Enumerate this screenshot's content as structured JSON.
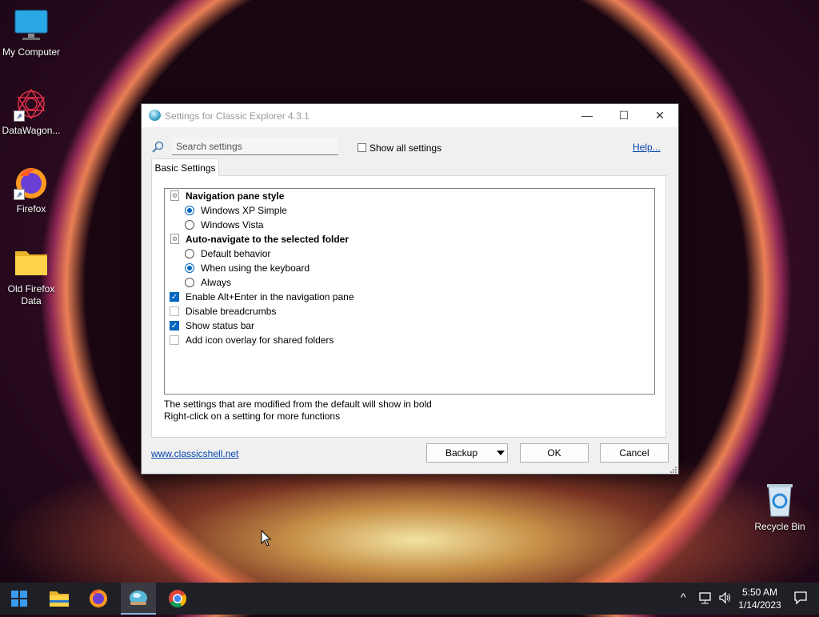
{
  "desktop": {
    "icons": [
      {
        "label": "My Computer",
        "icon": "monitor-icon"
      },
      {
        "label": "DataWagon...",
        "icon": "datawagon-icon"
      },
      {
        "label": "Firefox",
        "icon": "firefox-icon"
      },
      {
        "label": "Old Firefox Data",
        "icon": "folder-icon"
      },
      {
        "label": "Recycle Bin",
        "icon": "recycle-bin-icon"
      }
    ],
    "shortcut_glyph": "↗"
  },
  "window": {
    "title": "Settings for Classic Explorer 4.3.1",
    "controls": {
      "minimize": "—",
      "maximize": "☐",
      "close": "✕"
    },
    "search": {
      "placeholder": "Search settings",
      "value": ""
    },
    "show_all_settings": {
      "label": "Show all settings",
      "checked": false
    },
    "help_link": "Help...",
    "tab": "Basic Settings",
    "settings": [
      {
        "type": "group",
        "label": "Navigation pane style"
      },
      {
        "type": "radio",
        "label": "Windows XP Simple",
        "checked": true
      },
      {
        "type": "radio",
        "label": "Windows Vista",
        "checked": false
      },
      {
        "type": "group",
        "label": "Auto-navigate to the selected folder"
      },
      {
        "type": "radio",
        "label": "Default behavior",
        "checked": false
      },
      {
        "type": "radio",
        "label": "When using the keyboard",
        "checked": true
      },
      {
        "type": "radio",
        "label": "Always",
        "checked": false
      },
      {
        "type": "checkbox",
        "label": "Enable Alt+Enter in the navigation pane",
        "checked": true
      },
      {
        "type": "checkbox",
        "label": "Disable breadcrumbs",
        "checked": false
      },
      {
        "type": "checkbox",
        "label": "Show status bar",
        "checked": true
      },
      {
        "type": "checkbox",
        "label": "Add icon overlay for shared folders",
        "checked": false
      }
    ],
    "note_line1": "The settings that are modified from the default will show in bold",
    "note_line2": "Right-click on a setting for more functions",
    "website_link": "www.classicshell.net",
    "buttons": {
      "backup": "Backup",
      "ok": "OK",
      "cancel": "Cancel"
    }
  },
  "taskbar": {
    "items": [
      "start-icon",
      "file-explorer-icon",
      "firefox-icon",
      "classic-explorer-icon",
      "chrome-icon"
    ],
    "tray_chevron": "^",
    "time": "5:50 AM",
    "date": "1/14/2023"
  }
}
